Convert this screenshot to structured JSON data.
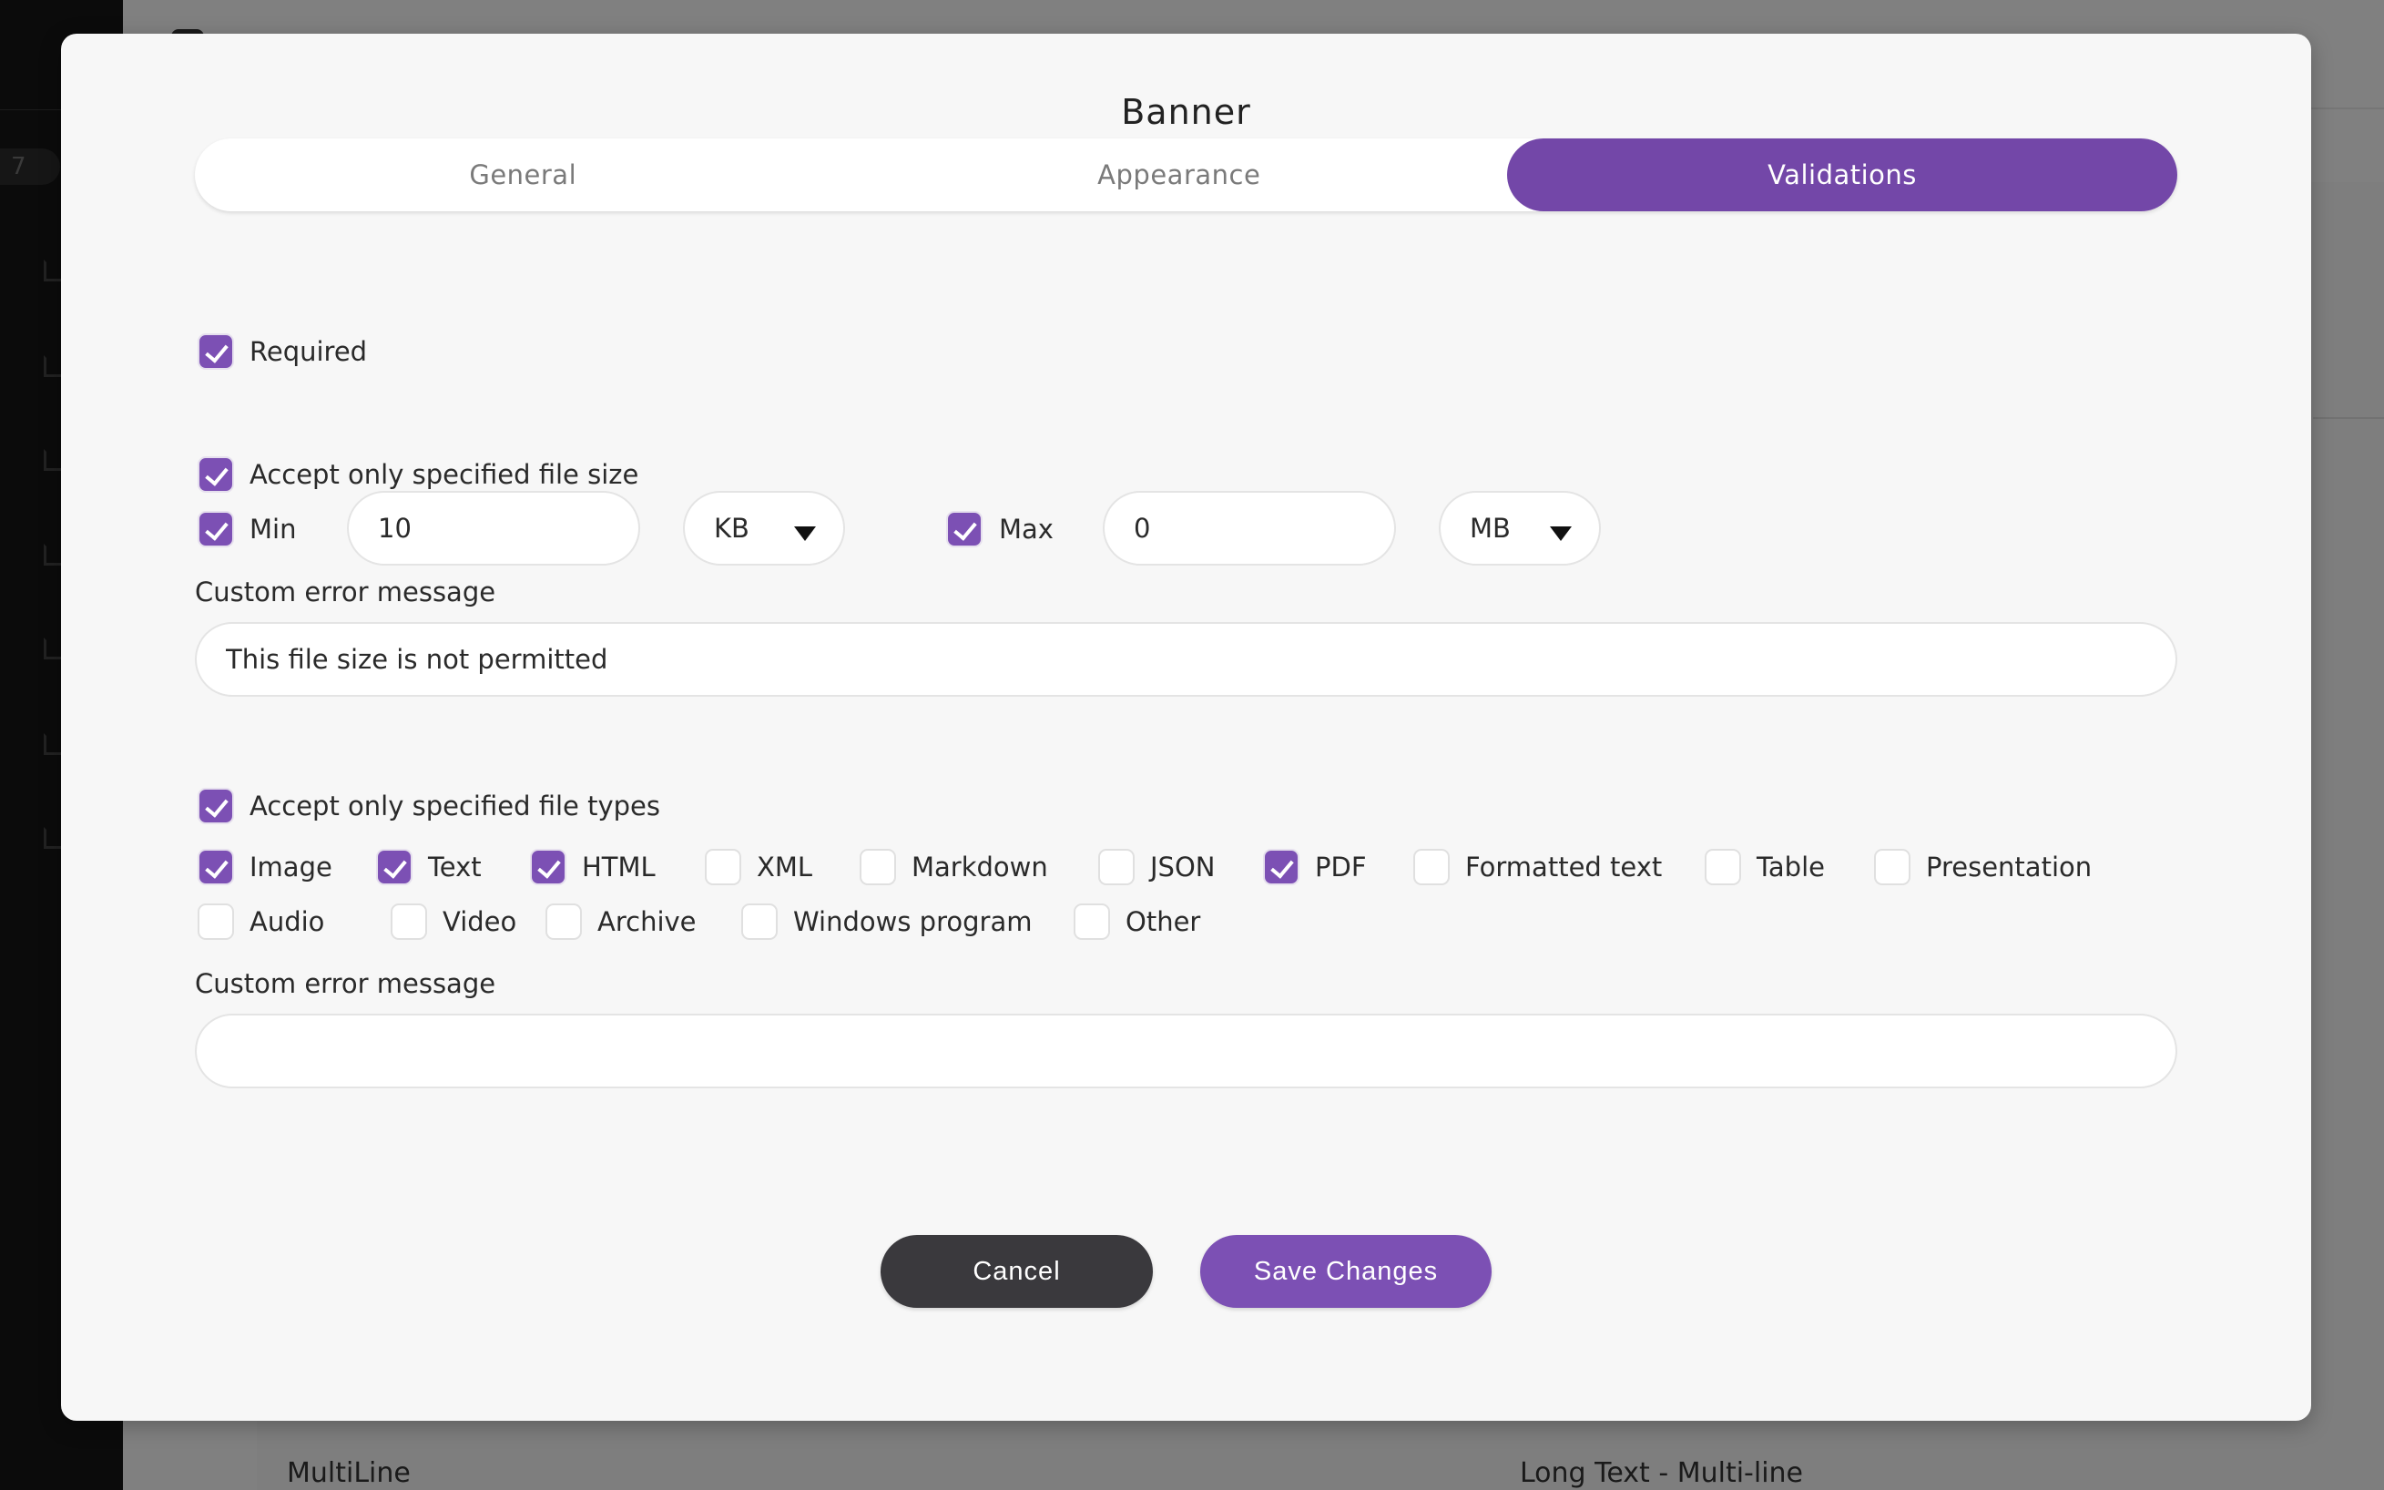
{
  "background": {
    "sidebar_badge": "7",
    "table_row": {
      "name": "MultiLine",
      "type": "Long Text - Multi-line"
    }
  },
  "modal": {
    "title": "Banner",
    "tabs": [
      {
        "label": "General",
        "active": false
      },
      {
        "label": "Appearance",
        "active": false
      },
      {
        "label": "Validations",
        "active": true
      }
    ],
    "required": {
      "label": "Required",
      "checked": true
    },
    "file_size": {
      "label": "Accept only specified file size",
      "checked": true,
      "min": {
        "label": "Min",
        "checked": true,
        "value": "10",
        "unit": "KB"
      },
      "max": {
        "label": "Max",
        "checked": true,
        "value": "0",
        "unit": "MB"
      },
      "error_label": "Custom error message",
      "error_value": "This file size is not permitted"
    },
    "file_types": {
      "label": "Accept only specified file types",
      "checked": true,
      "types": [
        {
          "label": "Image",
          "checked": true
        },
        {
          "label": "Text",
          "checked": true
        },
        {
          "label": "HTML",
          "checked": true
        },
        {
          "label": "XML",
          "checked": false
        },
        {
          "label": "Markdown",
          "checked": false
        },
        {
          "label": "JSON",
          "checked": false
        },
        {
          "label": "PDF",
          "checked": true
        },
        {
          "label": "Formatted text",
          "checked": false
        },
        {
          "label": "Table",
          "checked": false
        },
        {
          "label": "Presentation",
          "checked": false
        },
        {
          "label": "Audio",
          "checked": false
        },
        {
          "label": "Video",
          "checked": false
        },
        {
          "label": "Archive",
          "checked": false
        },
        {
          "label": "Windows program",
          "checked": false
        },
        {
          "label": "Other",
          "checked": false
        }
      ],
      "error_label": "Custom error message",
      "error_value": ""
    },
    "buttons": {
      "cancel": "Cancel",
      "save": "Save Changes"
    }
  },
  "colors": {
    "accent": "#7347a8",
    "checkbox": "#7c50b4",
    "cancel": "#3a393d"
  }
}
